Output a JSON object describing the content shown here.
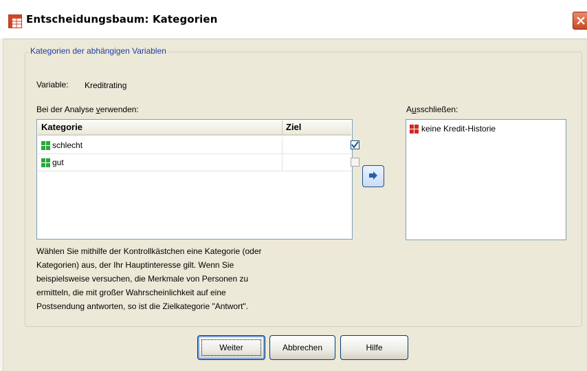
{
  "window": {
    "title": "Entscheidungsbaum: Kategorien"
  },
  "group": {
    "legend": "Kategorien der abhängigen Variablen"
  },
  "variable": {
    "label": "Variable:",
    "value": "Kreditrating"
  },
  "use_list": {
    "label_prefix": "Bei der Analyse ",
    "label_mnemonic": "v",
    "label_suffix": "erwenden:",
    "columns": [
      "Kategorie",
      "Ziel"
    ],
    "rows": [
      {
        "label": "schlecht",
        "target": true
      },
      {
        "label": "gut",
        "target": false
      }
    ]
  },
  "exclude_list": {
    "label_prefix": "A",
    "label_mnemonic": "u",
    "label_suffix": "sschließen:",
    "items": [
      "keine Kredit-Historie"
    ]
  },
  "help_text": [
    "Wählen Sie mithilfe der Kontrollkästchen eine Kategorie (oder",
    "Kategorien) aus, der Ihr Hauptinteresse gilt. Wenn Sie",
    "beispielsweise versuchen, die Merkmale von Personen zu",
    "ermitteln, die mit großer Wahrscheinlichkeit auf eine",
    "Postsendung antworten, so ist die Zielkategorie \"Antwort\"."
  ],
  "buttons": {
    "continue": "Weiter",
    "cancel": "Abbrechen",
    "help": "Hilfe"
  },
  "icons": {
    "app": "decision-tree-table-icon",
    "close": "close-icon",
    "move": "move-right-arrow-icon",
    "category_included": "green-category-icon",
    "category_excluded": "red-category-icon"
  },
  "colors": {
    "dialog_bg": "#ece9d8",
    "legend_text": "#1e3ca0",
    "included_icon": "#2aa83c",
    "excluded_icon": "#d22a1e",
    "check_mark": "#1c5180",
    "close_button": "#d8613c"
  }
}
